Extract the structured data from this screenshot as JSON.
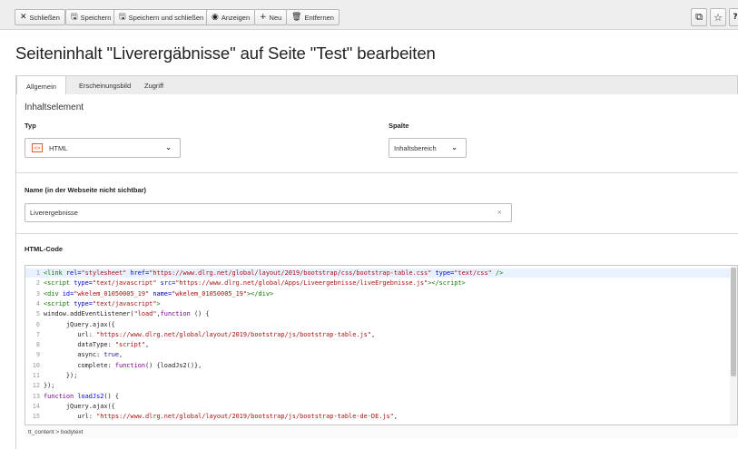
{
  "toolbar": {
    "close_label": "Schließen",
    "save_label": "Speichern",
    "save_close_label": "Speichern und schließen",
    "view_label": "Anzeigen",
    "new_label": "Neu",
    "delete_label": "Entfernen",
    "icons": [
      "close-icon",
      "save-icon",
      "save-close-icon",
      "eye-icon",
      "plus-icon",
      "trash-icon",
      "open-new-window-icon",
      "star-icon",
      "help-icon"
    ]
  },
  "page": {
    "title": "Seiteninhalt \"Liverergäbnisse\" auf Seite \"Test\" bearbeiten"
  },
  "tabs": [
    {
      "label": "Allgemein",
      "active": true
    },
    {
      "label": "Erscheinungsbild",
      "active": false
    },
    {
      "label": "Zugriff",
      "active": false
    }
  ],
  "content_element": {
    "section_title": "Inhaltselement",
    "type_label": "Typ",
    "type_value": "HTML",
    "column_label": "Spalte",
    "column_value": "Inhaltsbereich"
  },
  "name_field": {
    "label": "Name (in der Webseite nicht sichtbar)",
    "value": "Liverergebnisse"
  },
  "html_code": {
    "label": "HTML-Code",
    "lines": [
      {
        "n": "1",
        "html": "<span class=\"c-tag\">&lt;link</span> <span class=\"c-attr\">rel=</span><span class=\"c-str\">\"stylesheet\"</span> <span class=\"c-attr\">href=</span><span class=\"c-str\">\"https://www.dlrg.net/global/layout/2019/bootstrap/css/bootstrap-table.css\"</span> <span class=\"c-attr\">type=</span><span class=\"c-str\">\"text/css\"</span> <span class=\"c-tag\">/&gt;</span>"
      },
      {
        "n": "2",
        "html": "<span class=\"c-tag\">&lt;script</span> <span class=\"c-attr\">type=</span><span class=\"c-str\">\"text/javascript\"</span> <span class=\"c-attr\">src=</span><span class=\"c-str\">\"https://www.dlrg.net/global/Apps/Liveergebnisse/liveErgebnisse.js\"</span><span class=\"c-tag\">&gt;&lt;/script&gt;</span>"
      },
      {
        "n": "3",
        "html": "<span class=\"c-tag\">&lt;div</span> <span class=\"c-attr\">id=</span><span class=\"c-str\">\"wkelem_01050005_19\"</span> <span class=\"c-attr\">name=</span><span class=\"c-str\">\"wkelem_01050005_19\"</span><span class=\"c-tag\">&gt;&lt;/div&gt;</span>"
      },
      {
        "n": "4",
        "html": "<span class=\"c-tag\">&lt;script</span> <span class=\"c-attr\">type=</span><span class=\"c-str\">\"text/javascript\"</span><span class=\"c-tag\">&gt;</span>"
      },
      {
        "n": "5",
        "html": "window.addEventListener(<span class=\"c-str\">\"load\"</span>,<span class=\"c-kw\">function</span> () {"
      },
      {
        "n": "6",
        "html": "      jQuery.ajax({"
      },
      {
        "n": "7",
        "html": "         url: <span class=\"c-str\">\"https://www.dlrg.net/global/layout/2019/bootstrap/js/bootstrap-table.js\"</span>,"
      },
      {
        "n": "8",
        "html": "         dataType: <span class=\"c-str\">\"script\"</span>,"
      },
      {
        "n": "9",
        "html": "         async: <span class=\"c-atom\">true</span>,"
      },
      {
        "n": "10",
        "html": "         complete: <span class=\"c-kw\">function</span>() {loadJs2()},"
      },
      {
        "n": "11",
        "html": "      });"
      },
      {
        "n": "12",
        "html": "});"
      },
      {
        "n": "13",
        "html": "<span class=\"c-kw\">function</span> <span class=\"c-def\">loadJs2</span>() {"
      },
      {
        "n": "14",
        "html": "      jQuery.ajax({"
      },
      {
        "n": "15",
        "html": "         url: <span class=\"c-str\">\"https://www.dlrg.net/global/layout/2019/bootstrap/js/bootstrap-table-de-DE.js\"</span>,"
      }
    ],
    "path": "tt_content > bodytext"
  }
}
